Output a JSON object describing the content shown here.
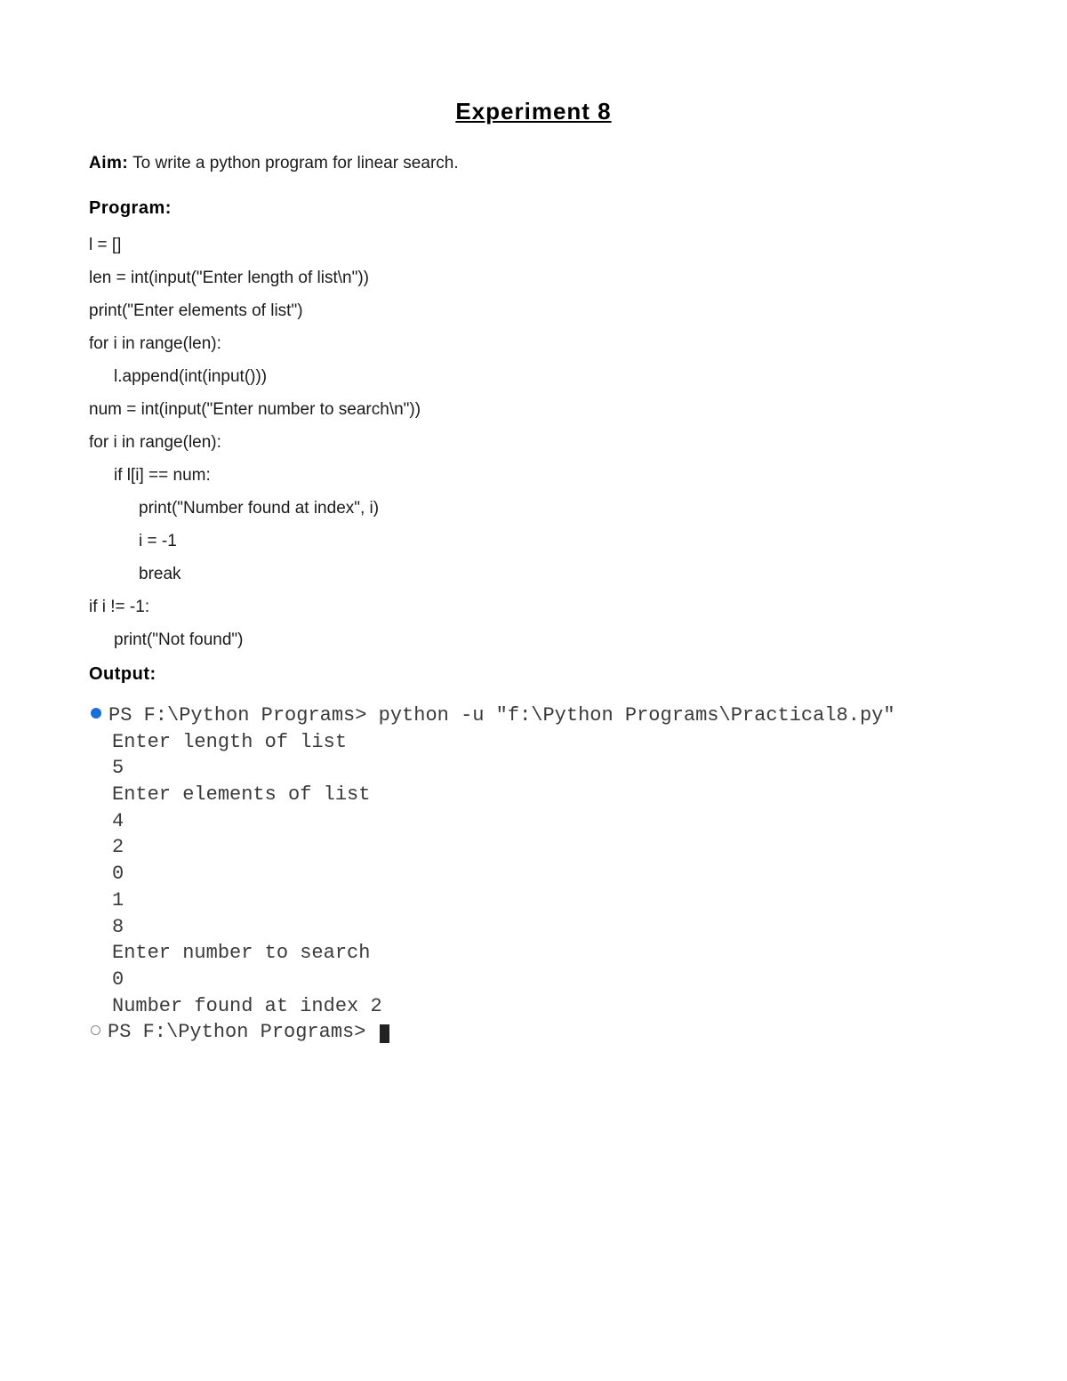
{
  "title": "Experiment 8",
  "aim": {
    "label": "Aim:",
    "text": " To write a python program for linear search."
  },
  "program": {
    "heading": "Program:",
    "lines": [
      {
        "text": "l = []",
        "indent": 0
      },
      {
        "text": "len = int(input(\"Enter length of list\\n\"))",
        "indent": 0
      },
      {
        "text": "print(\"Enter elements of list\")",
        "indent": 0
      },
      {
        "text": "for i in range(len):",
        "indent": 0
      },
      {
        "text": "l.append(int(input()))",
        "indent": 1
      },
      {
        "text": "num = int(input(\"Enter number to search\\n\"))",
        "indent": 0
      },
      {
        "text": "for i in range(len):",
        "indent": 0
      },
      {
        "text": "if l[i] == num:",
        "indent": 1
      },
      {
        "text": "print(\"Number found at index\", i)",
        "indent": 2
      },
      {
        "text": "i = -1",
        "indent": 2
      },
      {
        "text": "break",
        "indent": 2
      },
      {
        "text": "if i != -1:",
        "indent": 0
      },
      {
        "text": "print(\"Not found\")",
        "indent": 1
      }
    ]
  },
  "output": {
    "heading": "Output:",
    "prompt1": "PS F:\\Python Programs> python -u \"f:\\Python Programs\\Practical8.py\"",
    "lines": [
      "Enter length of list",
      "5",
      "Enter elements of list",
      "4",
      "2",
      "0",
      "1",
      "8",
      "Enter number to search",
      "0",
      "Number found at index 2"
    ],
    "prompt2": "PS F:\\Python Programs> "
  }
}
